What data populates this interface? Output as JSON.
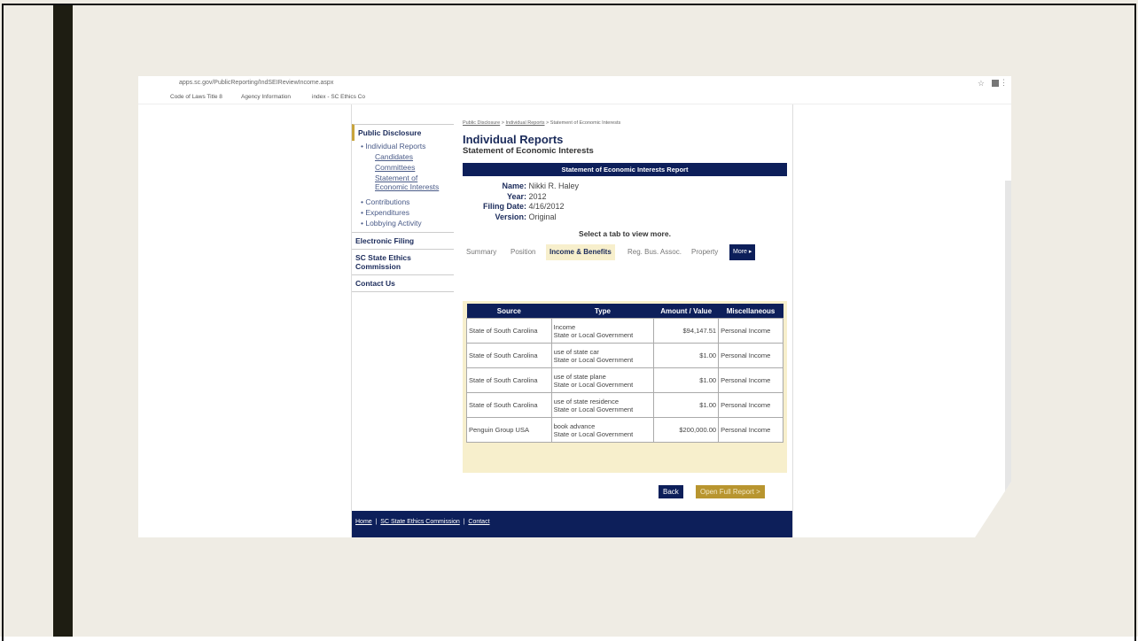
{
  "browser": {
    "url": "apps.sc.gov/PublicReporting/IndSEIReviewIncome.aspx",
    "bookmarks": [
      "Code of Laws Title 8",
      "Agency Information",
      "index - SC Ethics Co"
    ]
  },
  "sidebar": {
    "public_disclosure": "Public Disclosure",
    "individual_reports": "Individual Reports",
    "candidates": "Candidates",
    "committees": "Committees",
    "statement_line1": "Statement of",
    "statement_line2": "Economic Interests",
    "contributions": "Contributions",
    "expenditures": "Expenditures",
    "lobbying": "Lobbying Activity",
    "electronic_filing": "Electronic Filing",
    "commission_line1": "SC State Ethics",
    "commission_line2": "Commission",
    "contact_us": "Contact Us"
  },
  "breadcrumb": {
    "item1": "Public Disclosure",
    "item2": "Individual Reports",
    "item3": "Statement of Economic Interests",
    "separator": ">"
  },
  "main": {
    "title": "Individual Reports",
    "subtitle": "Statement of Economic Interests",
    "banner": "Statement of Economic Interests Report",
    "select_tab": "Select a tab to view more."
  },
  "filer": {
    "name_label": "Name:",
    "name": "Nikki R. Haley",
    "year_label": "Year:",
    "year": "2012",
    "filing_date_label": "Filing Date:",
    "filing_date": "4/16/2012",
    "version_label": "Version:",
    "version": "Original"
  },
  "tabs": [
    "Summary",
    "Position",
    "Income & Benefits",
    "Reg. Bus. Assoc.",
    "Property",
    "More ▸"
  ],
  "table": {
    "headers": [
      "Source",
      "Type",
      "Amount / Value",
      "Miscellaneous"
    ],
    "rows": [
      {
        "source": "State of South Carolina",
        "type1": "Income",
        "type2": "State or Local Government",
        "amount": "$94,147.51",
        "misc": "Personal Income"
      },
      {
        "source": "State of South Carolina",
        "type1": "use of state car",
        "type2": "State or Local Government",
        "amount": "$1.00",
        "misc": "Personal Income"
      },
      {
        "source": "State of South Carolina",
        "type1": "use of state plane",
        "type2": "State or Local Government",
        "amount": "$1.00",
        "misc": "Personal Income"
      },
      {
        "source": "State of South Carolina",
        "type1": "use of state residence",
        "type2": "State or Local Government",
        "amount": "$1.00",
        "misc": "Personal Income"
      },
      {
        "source": "Penguin Group USA",
        "type1": "book advance",
        "type2": "State or Local Government",
        "amount": "$200,000.00",
        "misc": "Personal Income"
      }
    ]
  },
  "buttons": {
    "back": "Back",
    "open_full": "Open Full Report >"
  },
  "footer": {
    "home": "Home",
    "commission": "SC State Ethics Commission",
    "contact": "Contact",
    "separator": "|"
  },
  "colors": {
    "navy": "#0d1f5a",
    "gold": "#b8952f",
    "panel": "#f7efcc",
    "slide_bg": "#efece4"
  }
}
